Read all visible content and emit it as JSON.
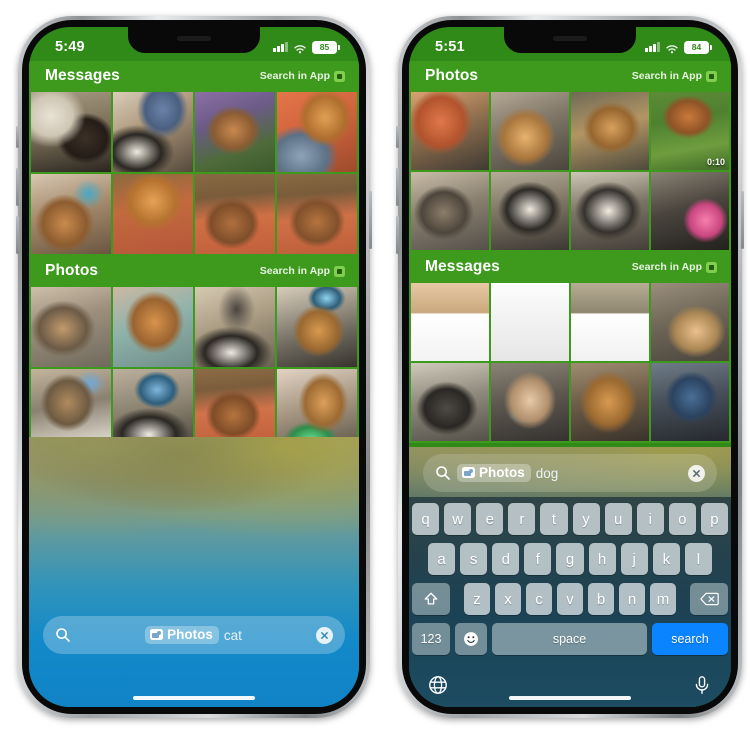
{
  "meta": {
    "green": "#3d9a1c",
    "accent_blue": "#0a84ff"
  },
  "phones": [
    {
      "id": "left",
      "status": {
        "time": "5:49",
        "battery": "85",
        "signal_icon": "cellular-bars-icon",
        "wifi_icon": "wifi-icon",
        "battery_icon": "battery-icon"
      },
      "sections": [
        {
          "title": "Messages",
          "action_label": "Search in App",
          "action_icon": "app-store-icon",
          "cells": [
            {
              "alt": "cat on windowsill",
              "duration": ""
            },
            {
              "alt": "person with cat on bed",
              "duration": ""
            },
            {
              "alt": "cat in purple garden",
              "duration": ""
            },
            {
              "alt": "orange tabby on couch",
              "duration": ""
            },
            {
              "alt": "orange cat close-up",
              "duration": ""
            },
            {
              "alt": "orange cat on blanket",
              "duration": ""
            },
            {
              "alt": "cat on orange blanket",
              "duration": ""
            },
            {
              "alt": "cat curled on blanket",
              "duration": ""
            }
          ]
        },
        {
          "title": "Photos",
          "action_label": "Search in App",
          "action_icon": "app-store-icon",
          "cells": [
            {
              "alt": "cat sleeping on bed",
              "duration": ""
            },
            {
              "alt": "tabby cat on chair",
              "duration": ""
            },
            {
              "alt": "person petting cat",
              "duration": ""
            },
            {
              "alt": "orange cat by tv",
              "duration": ""
            },
            {
              "alt": "tabby on patterned blanket",
              "duration": ""
            },
            {
              "alt": "cat on blanket with tv",
              "duration": ""
            },
            {
              "alt": "cat on orange knit blanket",
              "duration": ""
            },
            {
              "alt": "orange cat on desk",
              "duration": ""
            }
          ]
        }
      ],
      "search": {
        "magnifier_icon": "search-icon",
        "token_icon": "photos-app-icon",
        "token_label": "Photos",
        "query": "cat",
        "clear_icon": "clear-circle-icon"
      },
      "keyboard": null,
      "home_indicator": "home-indicator"
    },
    {
      "id": "right",
      "status": {
        "time": "5:51",
        "battery": "84",
        "signal_icon": "cellular-bars-icon",
        "wifi_icon": "wifi-icon",
        "battery_icon": "battery-icon"
      },
      "sections": [
        {
          "title": "Photos",
          "action_label": "Search in App",
          "action_icon": "app-store-icon",
          "cells": [
            {
              "alt": "dog with person on deck",
              "duration": ""
            },
            {
              "alt": "golden retriever on deck",
              "duration": ""
            },
            {
              "alt": "dog on wooden ramp",
              "duration": ""
            },
            {
              "alt": "corgi in grass video",
              "duration": "0:10"
            },
            {
              "alt": "dog lying on floor",
              "duration": ""
            },
            {
              "alt": "two dogs on blanket",
              "duration": ""
            },
            {
              "alt": "dog on cow-print blanket",
              "duration": ""
            },
            {
              "alt": "dog with pink toy",
              "duration": ""
            }
          ]
        },
        {
          "title": "Messages",
          "action_label": "Search in App",
          "action_icon": "app-store-icon",
          "cells": [
            {
              "alt": "dog photo with result card",
              "duration": ""
            },
            {
              "alt": "similar web images card",
              "duration": ""
            },
            {
              "alt": "dog photo with breed card",
              "duration": ""
            },
            {
              "alt": "fluffy dog on deck",
              "duration": ""
            },
            {
              "alt": "dog on couch",
              "duration": ""
            },
            {
              "alt": "hand with wristband",
              "duration": ""
            },
            {
              "alt": "golden retriever jumping",
              "duration": ""
            },
            {
              "alt": "dog in blue harness",
              "duration": ""
            }
          ]
        }
      ],
      "search": {
        "magnifier_icon": "search-icon",
        "token_icon": "photos-app-icon",
        "token_label": "Photos",
        "query": "dog",
        "clear_icon": "clear-circle-icon"
      },
      "keyboard": {
        "row1": [
          "q",
          "w",
          "e",
          "r",
          "t",
          "y",
          "u",
          "i",
          "o",
          "p"
        ],
        "row2": [
          "a",
          "s",
          "d",
          "f",
          "g",
          "h",
          "j",
          "k",
          "l"
        ],
        "row3_shift_icon": "shift-icon",
        "row3": [
          "z",
          "x",
          "c",
          "v",
          "b",
          "n",
          "m"
        ],
        "row3_backspace_icon": "backspace-icon",
        "numbers_label": "123",
        "emoji_icon": "emoji-icon",
        "space_label": "space",
        "search_label": "search",
        "globe_icon": "globe-icon",
        "mic_icon": "microphone-icon"
      },
      "home_indicator": "home-indicator"
    }
  ]
}
